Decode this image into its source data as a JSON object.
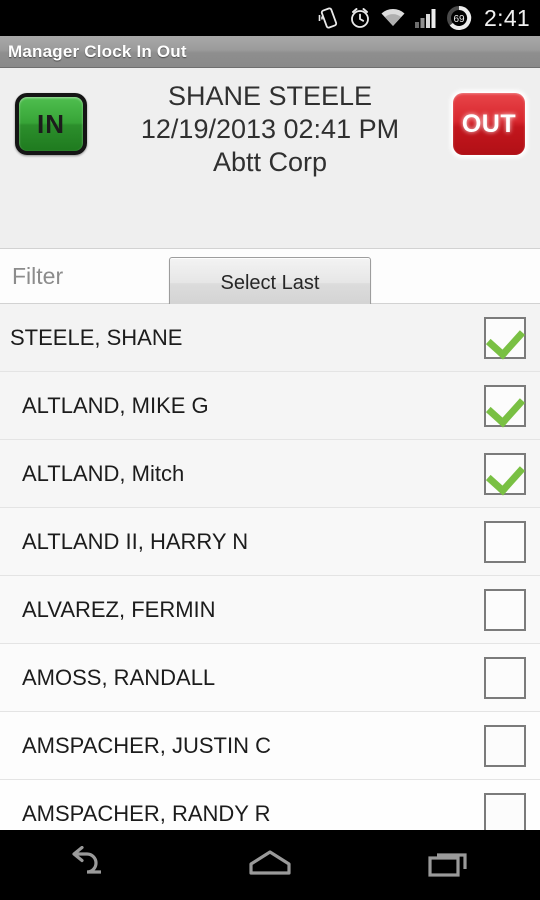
{
  "statusbar": {
    "icons": [
      "vibrate-icon",
      "alarm-icon",
      "wifi-icon",
      "signal-icon",
      "battery-icon"
    ],
    "battery_level": "69",
    "time": "2:41"
  },
  "titlebar": {
    "title": "Manager Clock In Out"
  },
  "header": {
    "in_button_label": "IN",
    "out_button_label": "OUT",
    "employee_name": "SHANE STEELE",
    "datetime": "12/19/2013 02:41 PM",
    "company": "Abtt Corp",
    "select_last_label": "Select Last"
  },
  "filter": {
    "placeholder": "Filter",
    "value": ""
  },
  "list": {
    "rows": [
      {
        "name": "STEELE, SHANE",
        "checked": true
      },
      {
        "name": "ALTLAND, MIKE G",
        "checked": true
      },
      {
        "name": "ALTLAND, Mitch",
        "checked": true
      },
      {
        "name": "ALTLAND II, HARRY N",
        "checked": false
      },
      {
        "name": "ALVAREZ, FERMIN",
        "checked": false
      },
      {
        "name": "AMOSS, RANDALL",
        "checked": false
      },
      {
        "name": "AMSPACHER, JUSTIN C",
        "checked": false
      },
      {
        "name": "AMSPACHER, RANDY R",
        "checked": false
      }
    ]
  },
  "navbar": {
    "back_label": "back-icon",
    "home_label": "home-icon",
    "recents_label": "recents-icon"
  },
  "colors": {
    "accent_green": "#79c043",
    "in_green": "#37a437",
    "out_red": "#d8272e",
    "background": "#efefef",
    "title_gray": "#9b9b9b"
  }
}
